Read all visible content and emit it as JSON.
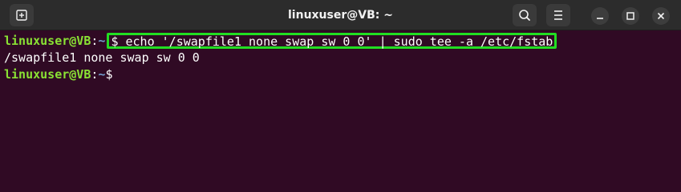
{
  "window": {
    "title": "linuxuser@VB: ~"
  },
  "titlebar": {
    "new_tab_icon": "new-tab-icon",
    "search_icon": "search-icon",
    "menu_icon": "hamburger-menu-icon",
    "minimize_icon": "minimize-icon",
    "maximize_icon": "maximize-icon",
    "close_icon": "close-icon"
  },
  "terminal": {
    "prompt_user": "linuxuser@VB",
    "prompt_colon": ":",
    "prompt_path": "~",
    "prompt_symbol": "$",
    "command": "$ echo '/swapfile1 none swap sw 0 0' | sudo tee -a /etc/fstab",
    "output": "/swapfile1 none swap sw 0 0",
    "prompt2_user": "linuxuser@VB",
    "prompt2_colon": ":",
    "prompt2_path": "~",
    "prompt2_symbol": "$"
  },
  "colors": {
    "background": "#300a24",
    "titlebar": "#2c2c2c",
    "user": "#8ae234",
    "path": "#729fcf",
    "highlight_box": "#22dd22"
  }
}
